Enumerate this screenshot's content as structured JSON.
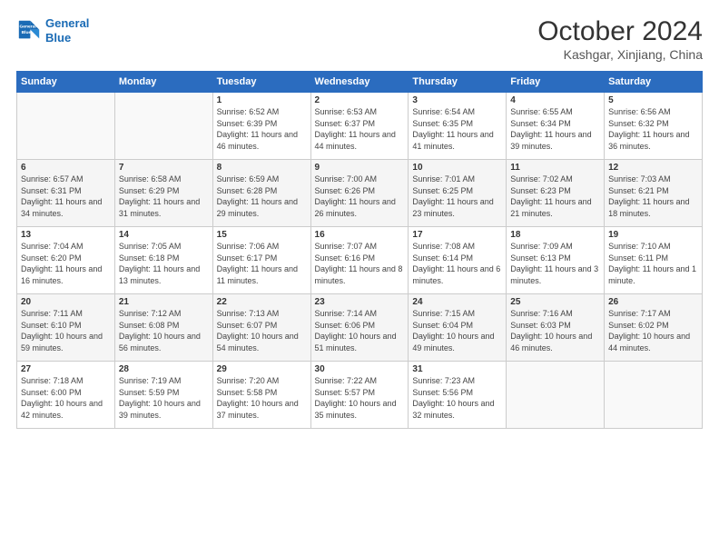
{
  "header": {
    "logo_line1": "General",
    "logo_line2": "Blue",
    "month": "October 2024",
    "location": "Kashgar, Xinjiang, China"
  },
  "weekdays": [
    "Sunday",
    "Monday",
    "Tuesday",
    "Wednesday",
    "Thursday",
    "Friday",
    "Saturday"
  ],
  "weeks": [
    [
      {
        "day": "",
        "detail": ""
      },
      {
        "day": "",
        "detail": ""
      },
      {
        "day": "1",
        "detail": "Sunrise: 6:52 AM\nSunset: 6:39 PM\nDaylight: 11 hours and 46 minutes."
      },
      {
        "day": "2",
        "detail": "Sunrise: 6:53 AM\nSunset: 6:37 PM\nDaylight: 11 hours and 44 minutes."
      },
      {
        "day": "3",
        "detail": "Sunrise: 6:54 AM\nSunset: 6:35 PM\nDaylight: 11 hours and 41 minutes."
      },
      {
        "day": "4",
        "detail": "Sunrise: 6:55 AM\nSunset: 6:34 PM\nDaylight: 11 hours and 39 minutes."
      },
      {
        "day": "5",
        "detail": "Sunrise: 6:56 AM\nSunset: 6:32 PM\nDaylight: 11 hours and 36 minutes."
      }
    ],
    [
      {
        "day": "6",
        "detail": "Sunrise: 6:57 AM\nSunset: 6:31 PM\nDaylight: 11 hours and 34 minutes."
      },
      {
        "day": "7",
        "detail": "Sunrise: 6:58 AM\nSunset: 6:29 PM\nDaylight: 11 hours and 31 minutes."
      },
      {
        "day": "8",
        "detail": "Sunrise: 6:59 AM\nSunset: 6:28 PM\nDaylight: 11 hours and 29 minutes."
      },
      {
        "day": "9",
        "detail": "Sunrise: 7:00 AM\nSunset: 6:26 PM\nDaylight: 11 hours and 26 minutes."
      },
      {
        "day": "10",
        "detail": "Sunrise: 7:01 AM\nSunset: 6:25 PM\nDaylight: 11 hours and 23 minutes."
      },
      {
        "day": "11",
        "detail": "Sunrise: 7:02 AM\nSunset: 6:23 PM\nDaylight: 11 hours and 21 minutes."
      },
      {
        "day": "12",
        "detail": "Sunrise: 7:03 AM\nSunset: 6:21 PM\nDaylight: 11 hours and 18 minutes."
      }
    ],
    [
      {
        "day": "13",
        "detail": "Sunrise: 7:04 AM\nSunset: 6:20 PM\nDaylight: 11 hours and 16 minutes."
      },
      {
        "day": "14",
        "detail": "Sunrise: 7:05 AM\nSunset: 6:18 PM\nDaylight: 11 hours and 13 minutes."
      },
      {
        "day": "15",
        "detail": "Sunrise: 7:06 AM\nSunset: 6:17 PM\nDaylight: 11 hours and 11 minutes."
      },
      {
        "day": "16",
        "detail": "Sunrise: 7:07 AM\nSunset: 6:16 PM\nDaylight: 11 hours and 8 minutes."
      },
      {
        "day": "17",
        "detail": "Sunrise: 7:08 AM\nSunset: 6:14 PM\nDaylight: 11 hours and 6 minutes."
      },
      {
        "day": "18",
        "detail": "Sunrise: 7:09 AM\nSunset: 6:13 PM\nDaylight: 11 hours and 3 minutes."
      },
      {
        "day": "19",
        "detail": "Sunrise: 7:10 AM\nSunset: 6:11 PM\nDaylight: 11 hours and 1 minute."
      }
    ],
    [
      {
        "day": "20",
        "detail": "Sunrise: 7:11 AM\nSunset: 6:10 PM\nDaylight: 10 hours and 59 minutes."
      },
      {
        "day": "21",
        "detail": "Sunrise: 7:12 AM\nSunset: 6:08 PM\nDaylight: 10 hours and 56 minutes."
      },
      {
        "day": "22",
        "detail": "Sunrise: 7:13 AM\nSunset: 6:07 PM\nDaylight: 10 hours and 54 minutes."
      },
      {
        "day": "23",
        "detail": "Sunrise: 7:14 AM\nSunset: 6:06 PM\nDaylight: 10 hours and 51 minutes."
      },
      {
        "day": "24",
        "detail": "Sunrise: 7:15 AM\nSunset: 6:04 PM\nDaylight: 10 hours and 49 minutes."
      },
      {
        "day": "25",
        "detail": "Sunrise: 7:16 AM\nSunset: 6:03 PM\nDaylight: 10 hours and 46 minutes."
      },
      {
        "day": "26",
        "detail": "Sunrise: 7:17 AM\nSunset: 6:02 PM\nDaylight: 10 hours and 44 minutes."
      }
    ],
    [
      {
        "day": "27",
        "detail": "Sunrise: 7:18 AM\nSunset: 6:00 PM\nDaylight: 10 hours and 42 minutes."
      },
      {
        "day": "28",
        "detail": "Sunrise: 7:19 AM\nSunset: 5:59 PM\nDaylight: 10 hours and 39 minutes."
      },
      {
        "day": "29",
        "detail": "Sunrise: 7:20 AM\nSunset: 5:58 PM\nDaylight: 10 hours and 37 minutes."
      },
      {
        "day": "30",
        "detail": "Sunrise: 7:22 AM\nSunset: 5:57 PM\nDaylight: 10 hours and 35 minutes."
      },
      {
        "day": "31",
        "detail": "Sunrise: 7:23 AM\nSunset: 5:56 PM\nDaylight: 10 hours and 32 minutes."
      },
      {
        "day": "",
        "detail": ""
      },
      {
        "day": "",
        "detail": ""
      }
    ]
  ]
}
